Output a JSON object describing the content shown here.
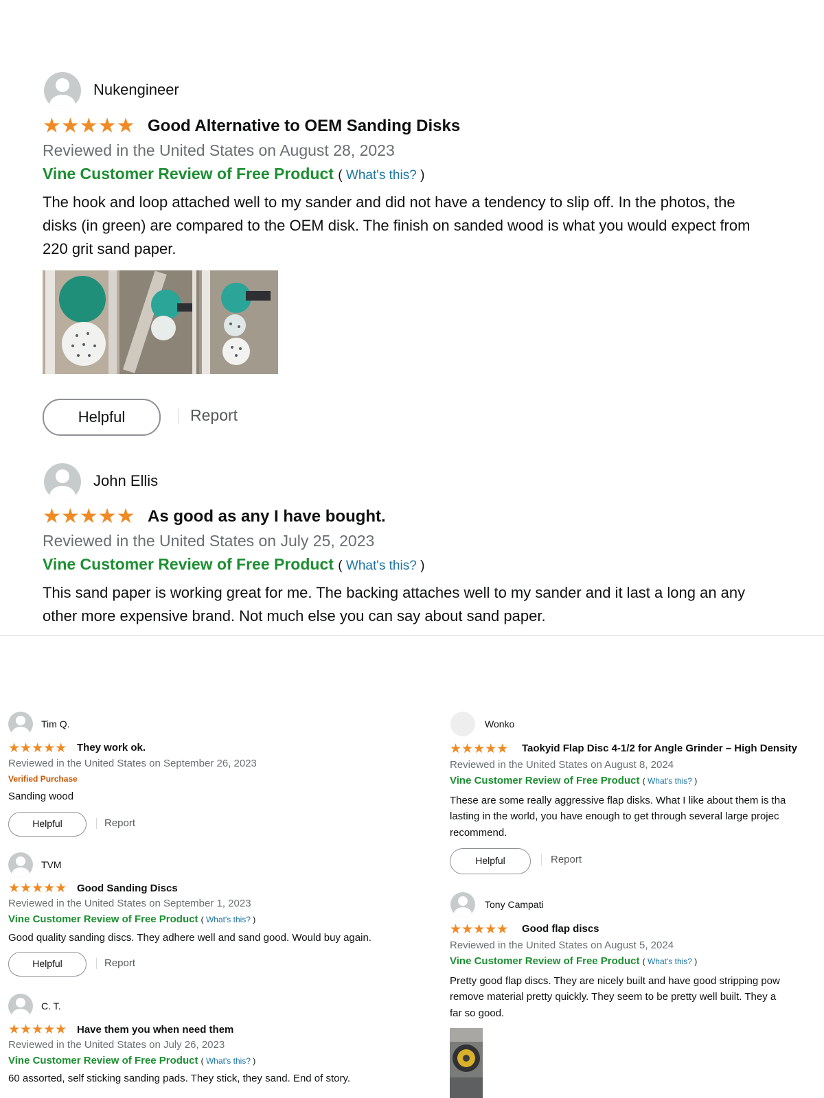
{
  "top_reviews": [
    {
      "name": "Nukengineer",
      "stars": "★★★★★",
      "title": "Good Alternative to OEM Sanding Disks",
      "meta": "Reviewed in the United States on August 28, 2023",
      "vine": "Vine Customer Review of Free Product",
      "whats_this": "What's this?",
      "body_lines": [
        "The hook and loop attached well to my sander and did not have a tendency to slip off. In the photos, the",
        "disks (in green) are compared to the OEM disk. The finish on sanded wood is what you would expect from",
        "220 grit sand paper."
      ],
      "helpful": "Helpful",
      "report": "Report"
    },
    {
      "name": "John Ellis",
      "stars": "★★★★★",
      "title": "As good as any I have bought.",
      "meta": "Reviewed in the United States on July 25, 2023",
      "vine": "Vine Customer Review of Free Product",
      "whats_this": "What's this?",
      "body_lines": [
        "This sand paper is working great for me. The backing attaches well to my sander and it last a long an any",
        "other more expensive brand. Not much else you can say about sand paper."
      ]
    }
  ],
  "left_reviews": [
    {
      "name": "Tim Q.",
      "stars": "★★★★★",
      "title": "They work ok.",
      "meta": "Reviewed in the United States on September 26, 2023",
      "verified": "Verified Purchase",
      "body": "Sanding wood",
      "helpful": "Helpful",
      "report": "Report"
    },
    {
      "name": "TVM",
      "stars": "★★★★★",
      "title": "Good Sanding Discs",
      "meta": "Reviewed in the United States on September 1, 2023",
      "vine": "Vine Customer Review of Free Product",
      "whats_this": "What's this?",
      "body": "Good quality sanding discs. They adhere well and sand good. Would buy again.",
      "helpful": "Helpful",
      "report": "Report"
    },
    {
      "name": "C. T.",
      "stars": "★★★★★",
      "title": "Have them you when need them",
      "meta": "Reviewed in the United States on July 26, 2023",
      "vine": "Vine Customer Review of Free Product",
      "whats_this": "What's this?",
      "body": "60 assorted, self sticking sanding pads. They stick, they sand. End of story."
    }
  ],
  "right_reviews": [
    {
      "name": "Wonko",
      "stars": "★★★★★",
      "title": "Taokyid Flap Disc 4-1/2 for Angle Grinder – High Density",
      "meta": "Reviewed in the United States on August 8, 2024",
      "vine": "Vine Customer Review of Free Product",
      "whats_this": "What's this?",
      "body_lines": [
        "These are some really aggressive flap disks. What I like about them is tha",
        "lasting in the world, you have enough to get through several large projec",
        "recommend."
      ],
      "helpful": "Helpful",
      "report": "Report"
    },
    {
      "name": "Tony Campati",
      "stars": "★★★★★",
      "title": "Good flap discs",
      "meta": "Reviewed in the United States on August 5, 2024",
      "vine": "Vine Customer Review of Free Product",
      "whats_this": "What's this?",
      "body_lines": [
        "Pretty good flap discs. They are nicely built and have good stripping pow",
        "remove material pretty quickly. They seem to be pretty well built. They a",
        "far so good."
      ]
    }
  ],
  "colors": {
    "star": "#f08a24",
    "vine_green": "#1d8f32",
    "link_blue": "#1a73a3",
    "verified_orange": "#c45500",
    "meta_gray": "#6a6f73"
  }
}
